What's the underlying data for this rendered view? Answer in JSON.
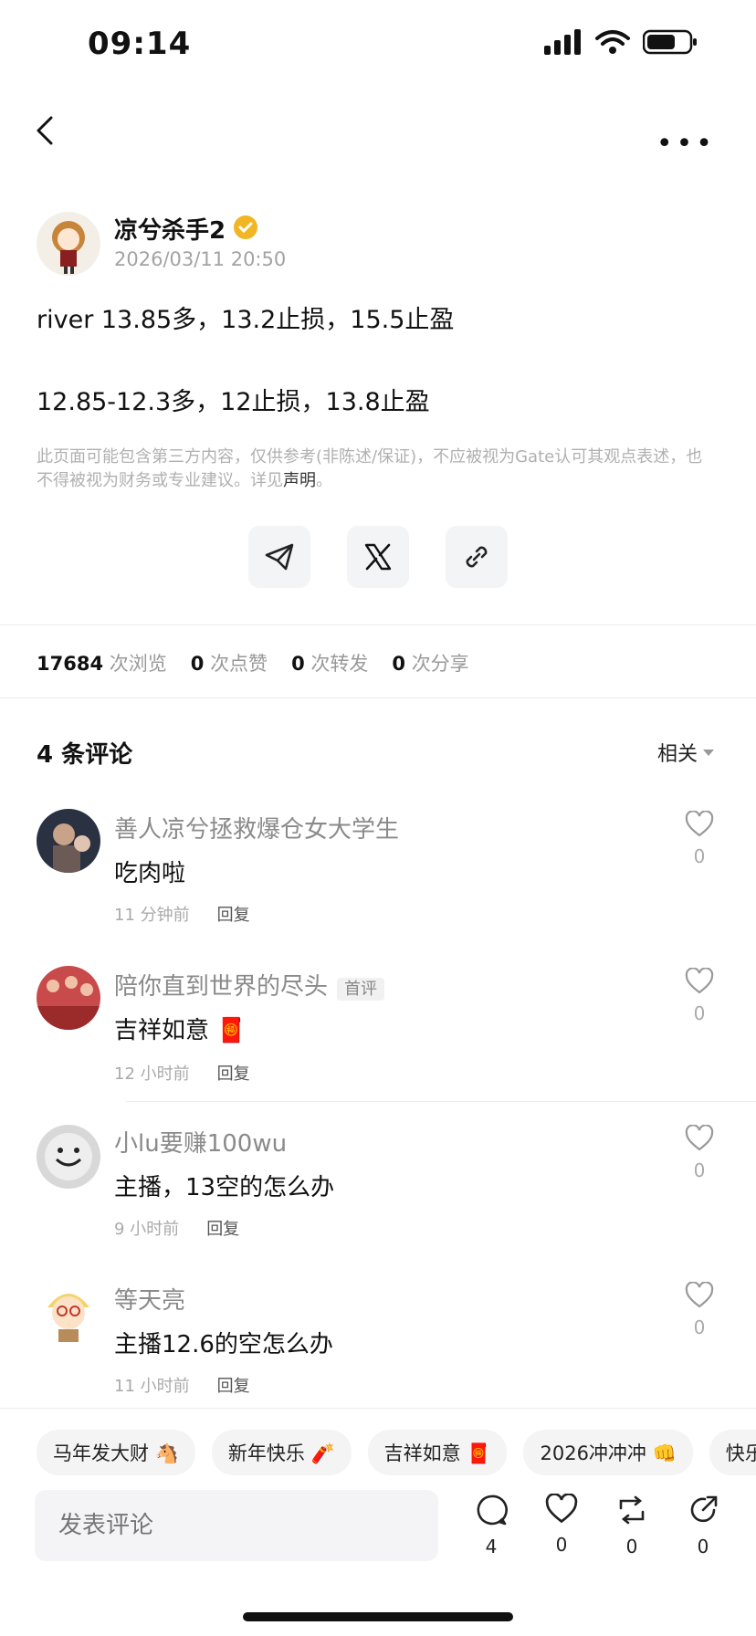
{
  "status_bar": {
    "time": "09:14"
  },
  "author": {
    "name": "凉兮杀手2",
    "date": "2026/03/11 20:50"
  },
  "post": {
    "line1": "river 13.85多，13.2止损，15.5止盈",
    "line2": "12.85-12.3多，12止损，13.8止盈"
  },
  "disclaimer": {
    "text": "此页面可能包含第三方内容，仅供参考(非陈述/保证)，不应被视为Gate认可其观点表述，也不得被视为财务或专业建议。详见",
    "link": "声明",
    "end": "。"
  },
  "stats": {
    "views": "17684",
    "views_label": "次浏览",
    "likes": "0",
    "likes_label": "次点赞",
    "reposts": "0",
    "reposts_label": "次转发",
    "shares": "0",
    "shares_label": "次分享"
  },
  "comments_header": {
    "title": "4 条评论",
    "sort": "相关"
  },
  "comments": [
    {
      "name": "善人凉兮拯救爆仓女大学生",
      "text": "吃肉啦",
      "time": "11 分钟前",
      "reply": "回复",
      "likes": "0"
    },
    {
      "name": "陪你直到世界的尽头",
      "badge": "首评",
      "text": "吉祥如意 🧧",
      "time": "12 小时前",
      "reply": "回复",
      "likes": "0"
    },
    {
      "name": "小lu要赚100wu",
      "text": "主播，13空的怎么办",
      "time": "9 小时前",
      "reply": "回复",
      "likes": "0"
    },
    {
      "name": "等天亮",
      "text": "主播12.6的空怎么办",
      "time": "11 小时前",
      "reply": "回复",
      "likes": "0"
    }
  ],
  "chips": [
    "马年发大财 🐴",
    "新年快乐 🧨",
    "吉祥如意 🧧",
    "2026冲冲冲 👊",
    "快乐"
  ],
  "bottom_bar": {
    "placeholder": "发表评论",
    "comment_count": "4",
    "like_count": "0",
    "repost_count": "0",
    "share_count": "0"
  },
  "colors": {
    "verified": "#f2b524",
    "muted": "#a3a3a3"
  },
  "icons": [
    "back-icon",
    "more-icon",
    "telegram-icon",
    "x-icon",
    "link-icon",
    "heart-icon",
    "comment-icon",
    "repost-icon",
    "share-icon"
  ]
}
